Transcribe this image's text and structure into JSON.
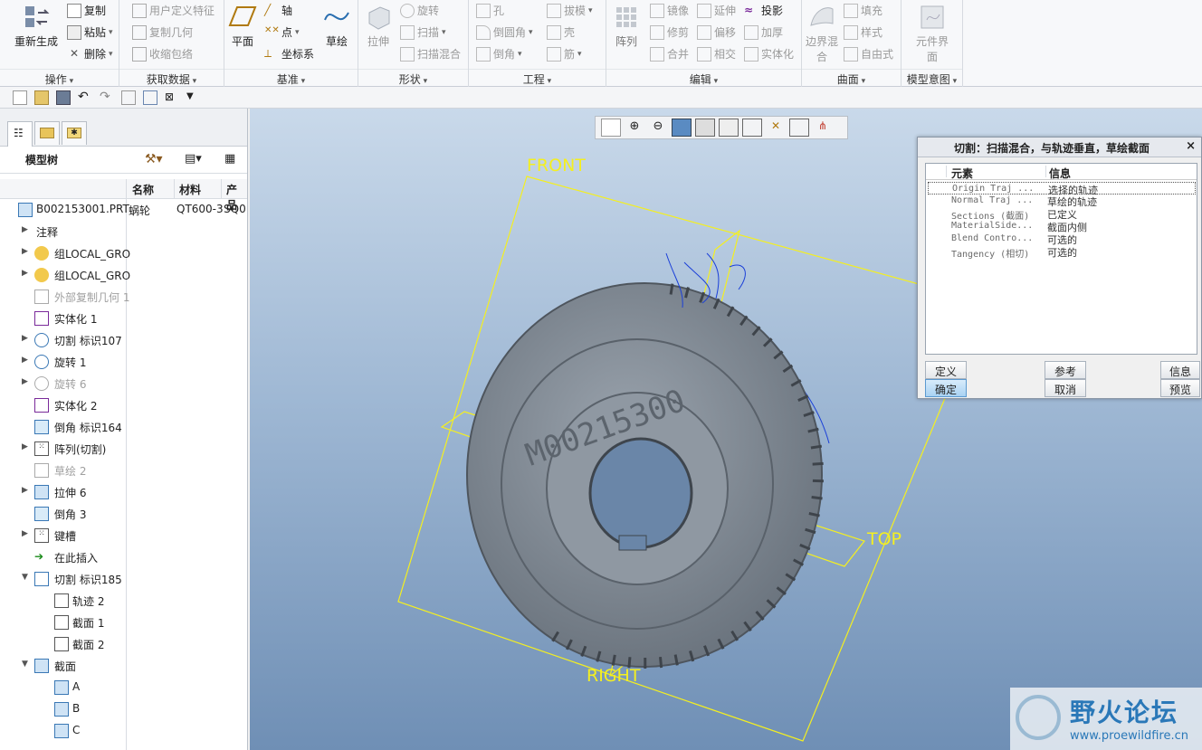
{
  "ribbon": {
    "operations": {
      "label": "操作",
      "regen": "重新生成",
      "copy": "复制",
      "paste": "粘贴",
      "delete": "删除"
    },
    "getdata": {
      "label": "获取数据",
      "udf": "用户定义特征",
      "copygeom": "复制几何",
      "shrinkwrap": "收缩包络"
    },
    "datum": {
      "label": "基准",
      "plane": "平面",
      "axis": "轴",
      "point": "点",
      "csys": "坐标系",
      "sketch": "草绘"
    },
    "shapes": {
      "label": "形状",
      "extrude": "拉伸",
      "revolve": "旋转",
      "sweep": "扫描",
      "sweptblend": "扫描混合"
    },
    "engineering": {
      "label": "工程",
      "hole": "孔",
      "round": "倒圆角",
      "chamfer": "倒角",
      "draft": "拔模",
      "shell": "壳",
      "rib": "筋"
    },
    "editing": {
      "label": "编辑",
      "pattern": "阵列",
      "mirror": "镜像",
      "trim": "修剪",
      "merge": "合并",
      "extend": "延伸",
      "offset": "偏移",
      "intersect": "相交",
      "project": "投影",
      "thicken": "加厚",
      "solidify": "实体化"
    },
    "surfaces": {
      "label": "曲面",
      "boundaryblend": "边界混合",
      "fill": "填充",
      "style": "样式",
      "freestyle": "自由式"
    },
    "modelintent": {
      "label": "模型意图",
      "component": "元件界面"
    }
  },
  "tree": {
    "title": "模型树",
    "columns": [
      "名称",
      "材料",
      "产品"
    ],
    "rows": [
      {
        "label": "B002153001.PRT",
        "c2": "蜗轮",
        "c3": "QT600-3",
        "c4": "SQ0"
      },
      {
        "label": "注释"
      },
      {
        "label": "组LOCAL_GRO"
      },
      {
        "label": "组LOCAL_GRO"
      },
      {
        "label": "外部复制几何 1"
      },
      {
        "label": "实体化 1"
      },
      {
        "label": "切割 标识107"
      },
      {
        "label": "旋转 1"
      },
      {
        "label": "旋转 6"
      },
      {
        "label": "实体化 2"
      },
      {
        "label": "倒角 标识164"
      },
      {
        "label": "阵列(切割)"
      },
      {
        "label": "草绘 2"
      },
      {
        "label": "拉伸 6"
      },
      {
        "label": "倒角 3"
      },
      {
        "label": "键槽"
      },
      {
        "label": "在此插入"
      },
      {
        "label": "切割 标识185"
      },
      {
        "label": "轨迹 2"
      },
      {
        "label": "截面 1"
      },
      {
        "label": "截面 2"
      },
      {
        "label": "截面"
      },
      {
        "label": "A"
      },
      {
        "label": "B"
      },
      {
        "label": "C"
      }
    ]
  },
  "viewport": {
    "datum_front": "FRONT",
    "datum_top": "TOP",
    "datum_right": "RIGHT",
    "engraving": "M00215300"
  },
  "dialog": {
    "title": "切割：扫描混合，与轨迹垂直，草绘截面",
    "col_element": "元素",
    "col_info": "信息",
    "rows": [
      {
        "e": "Origin Traj ...",
        "v": "选择的轨迹"
      },
      {
        "e": "Normal Traj ...",
        "v": "草绘的轨迹"
      },
      {
        "e": "Sections (截面)",
        "v": "已定义"
      },
      {
        "e": "MaterialSide...",
        "v": "截面内侧"
      },
      {
        "e": "Blend Contro...",
        "v": "可选的"
      },
      {
        "e": "Tangency (相切)",
        "v": "可选的"
      }
    ],
    "btn_define": "定义",
    "btn_refs": "参考",
    "btn_info": "信息",
    "btn_ok": "确定",
    "btn_cancel": "取消",
    "btn_preview": "预览"
  },
  "watermark": {
    "title": "野火论坛",
    "url": "www.proewildfire.cn"
  }
}
